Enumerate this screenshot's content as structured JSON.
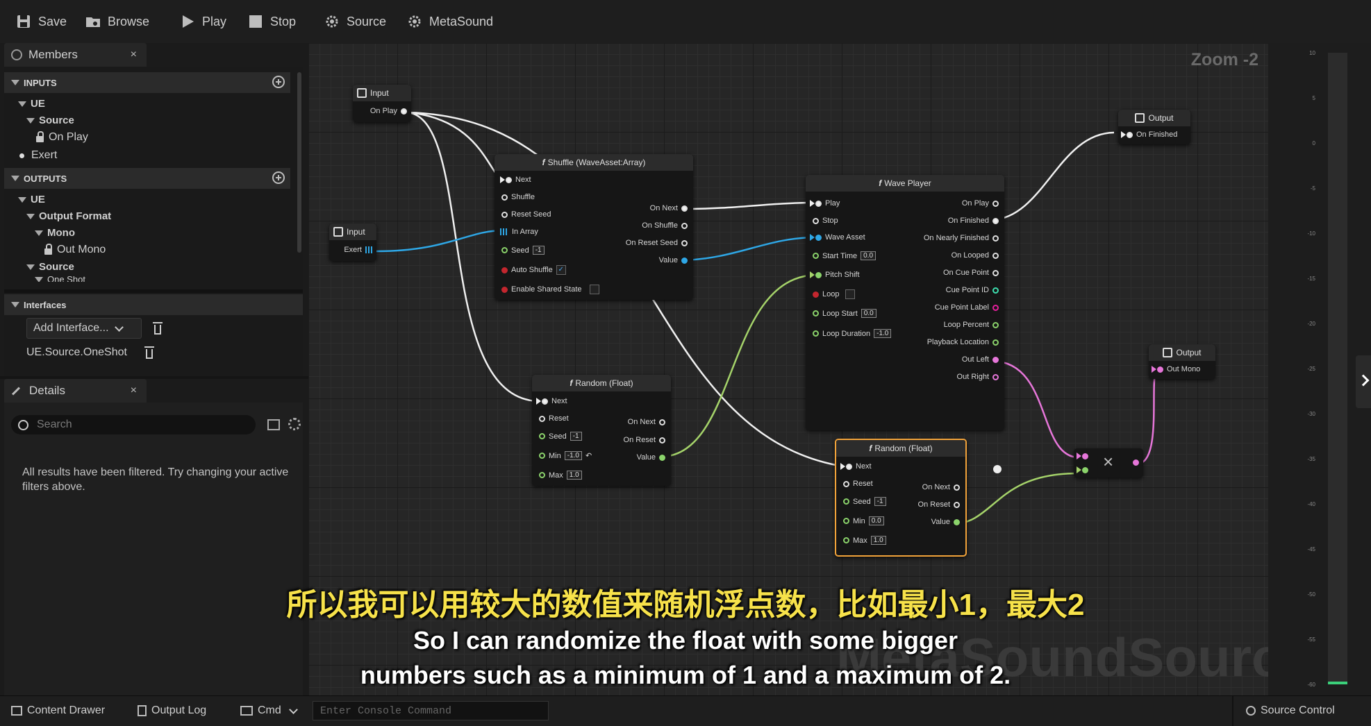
{
  "toolbar": {
    "save": "Save",
    "browse": "Browse",
    "play": "Play",
    "stop": "Stop",
    "source": "Source",
    "metasound": "MetaSound"
  },
  "members": {
    "tab_label": "Members",
    "close": "×",
    "inputs_header": "INPUTS",
    "inputs": [
      "UE",
      "Source",
      "On Play",
      "Exert"
    ],
    "outputs_header": "OUTPUTS",
    "outputs": [
      "UE",
      "Output Format",
      "Mono",
      "Out Mono",
      "Source",
      "One Shot"
    ],
    "interfaces_header": "Interfaces",
    "add_interface": "Add Interface...",
    "interface_item": "UE.Source.OneShot"
  },
  "details": {
    "tab_label": "Details",
    "close": "×",
    "search_placeholder": "Search",
    "filtered_msg": "All results have been filtered. Try changing your active filters above."
  },
  "graph": {
    "zoom": "Zoom -2",
    "watermark": "MetaSoundSource",
    "nodes": {
      "input1": {
        "title": "Input",
        "pin": "On Play"
      },
      "input2": {
        "title": "Input",
        "pin": "Exert"
      },
      "shuffle": {
        "title": "Shuffle (WaveAsset:Array)",
        "inputs": [
          "Next",
          "Shuffle",
          "Reset Seed",
          "In Array",
          "Seed",
          "Auto Shuffle",
          "Enable Shared State"
        ],
        "seed_val": "-1",
        "auto_shuffle_check": "✓",
        "outputs": [
          "On Next",
          "On Shuffle",
          "On Reset Seed",
          "Value"
        ]
      },
      "random1": {
        "title": "Random (Float)",
        "inputs": [
          "Next",
          "Reset",
          "Seed",
          "Min",
          "Max"
        ],
        "seed_val": "-1",
        "min_val": "-1.0",
        "max_val": "1.0",
        "outputs": [
          "On Next",
          "On Reset",
          "Value"
        ]
      },
      "wave_player": {
        "title": "Wave Player",
        "inputs": [
          "Play",
          "Stop",
          "Wave Asset",
          "Start Time",
          "Pitch Shift",
          "Loop",
          "Loop Start",
          "Loop Duration"
        ],
        "start_time_val": "0.0",
        "loop_start_val": "0.0",
        "loop_duration_val": "-1.0",
        "outputs": [
          "On Play",
          "On Finished",
          "On Nearly Finished",
          "On Looped",
          "On Cue Point",
          "Cue Point ID",
          "Cue Point Label",
          "Loop Percent",
          "Playback Location",
          "Out Left",
          "Out Right"
        ]
      },
      "random2": {
        "title": "Random (Float)",
        "inputs": [
          "Next",
          "Reset",
          "Seed",
          "Min",
          "Max"
        ],
        "seed_val": "-1",
        "min_val": "0.0",
        "max_val": "1.0",
        "outputs": [
          "On Next",
          "On Reset",
          "Value"
        ]
      },
      "output1": {
        "title": "Output",
        "pin": "On Finished"
      },
      "output2": {
        "title": "Output",
        "pin": "Out Mono"
      },
      "multiply": {
        "symbol": "×"
      }
    }
  },
  "meter_ticks": [
    "10",
    "5",
    "0",
    "-5",
    "-10",
    "-15",
    "-20",
    "-25",
    "-30",
    "-35",
    "-40",
    "-45",
    "-50",
    "-55",
    "-60"
  ],
  "statusbar": {
    "content_drawer": "Content Drawer",
    "output_log": "Output Log",
    "cmd": "Cmd",
    "console_placeholder": "Enter Console Command",
    "source_control": "Source Control"
  },
  "subtitles": {
    "cn": "所以我可以用较大的数值来随机浮点数，比如最小1，最大2",
    "en_line1": "So I can randomize the float with some bigger",
    "en_line2": "numbers such as a minimum of 1 and a maximum of 2."
  }
}
